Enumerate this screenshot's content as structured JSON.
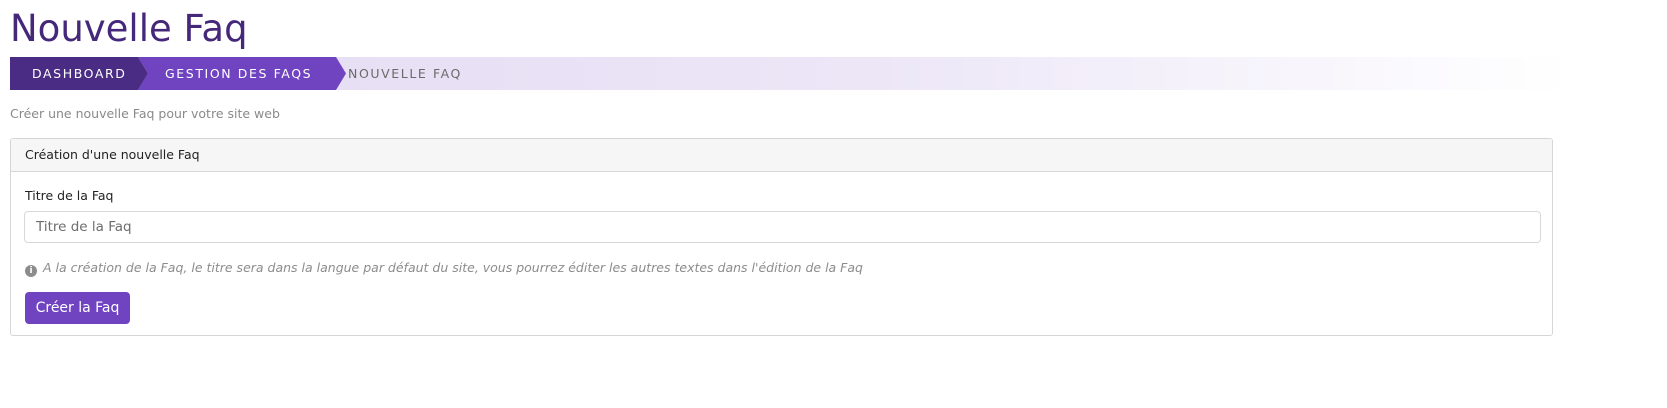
{
  "page": {
    "title": "Nouvelle Faq",
    "intro": "Créer une nouvelle Faq pour votre site web"
  },
  "breadcrumb": {
    "items": [
      {
        "label": "DASHBOARD",
        "color": "#4b2c84"
      },
      {
        "label": "GESTION DES FAQS",
        "color": "#7043c1"
      },
      {
        "label": "NOUVELLE FAQ"
      }
    ]
  },
  "card": {
    "header": "Création d'une nouvelle Faq",
    "field_label": "Titre de la Faq",
    "input_value": "",
    "input_placeholder": "Titre de la Faq",
    "help_icon": "info-circle-icon",
    "help_text": "A la création de la Faq, le titre sera dans la langue par défaut du site, vous pourrez éditer les autres textes dans l'édition de la Faq",
    "submit_label": "Créer la Faq"
  },
  "colors": {
    "title": "#45287a",
    "accent": "#7043c1",
    "accent_dark": "#4b2c84"
  }
}
